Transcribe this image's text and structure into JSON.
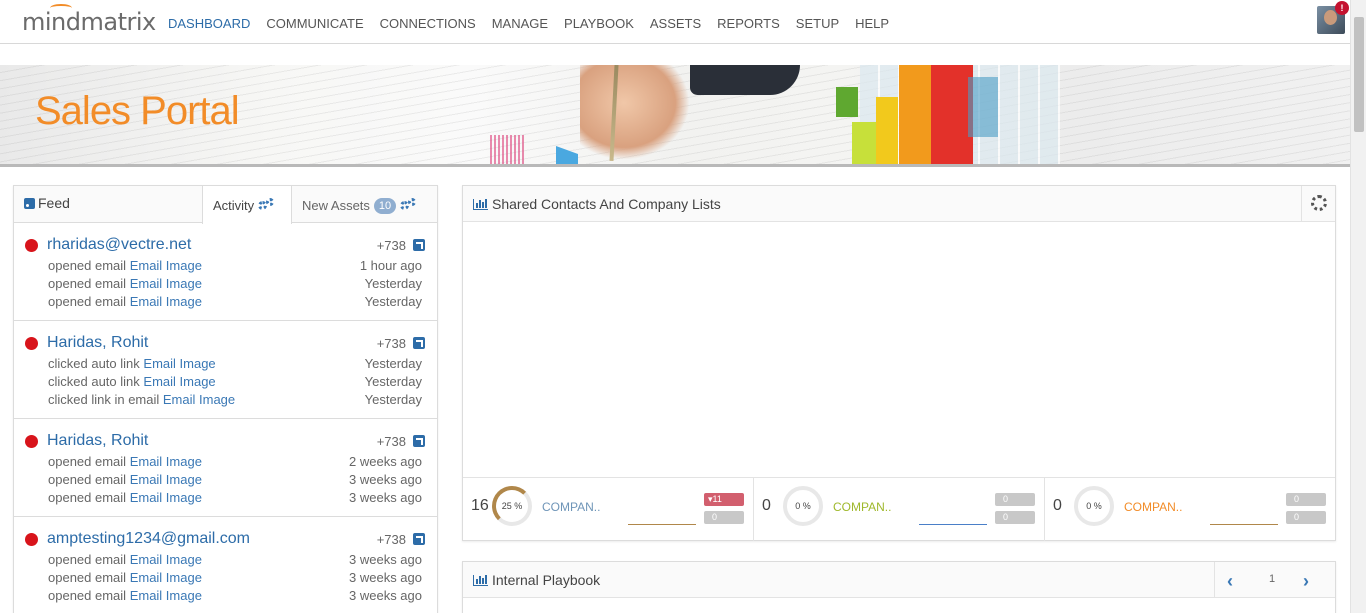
{
  "brand": {
    "logo_text": "mindmatrix"
  },
  "nav": {
    "items": [
      {
        "label": "DASHBOARD",
        "active": true
      },
      {
        "label": "COMMUNICATE"
      },
      {
        "label": "CONNECTIONS"
      },
      {
        "label": "MANAGE"
      },
      {
        "label": "PLAYBOOK"
      },
      {
        "label": "ASSETS"
      },
      {
        "label": "REPORTS"
      },
      {
        "label": "SETUP"
      },
      {
        "label": "HELP"
      }
    ],
    "notification_badge": "!"
  },
  "banner": {
    "title": "Sales Portal"
  },
  "feed": {
    "title": "Feed",
    "tab_activity": "Activity",
    "tab_new_assets": "New Assets",
    "new_assets_count": "10",
    "items": [
      {
        "name": "rharidas@vectre.net",
        "score": "+738",
        "activities": [
          {
            "action": "opened email",
            "link": "Email Image",
            "time": "1 hour ago"
          },
          {
            "action": "opened email",
            "link": "Email Image",
            "time": "Yesterday"
          },
          {
            "action": "opened email",
            "link": "Email Image",
            "time": "Yesterday"
          }
        ]
      },
      {
        "name": "Haridas, Rohit",
        "score": "+738",
        "activities": [
          {
            "action": "clicked auto link",
            "link": "Email Image",
            "time": "Yesterday"
          },
          {
            "action": "clicked auto link",
            "link": "Email Image",
            "time": "Yesterday"
          },
          {
            "action": "clicked link in email",
            "link": "Email Image",
            "time": "Yesterday"
          }
        ]
      },
      {
        "name": "Haridas, Rohit",
        "score": "+738",
        "activities": [
          {
            "action": "opened email",
            "link": "Email Image",
            "time": "2 weeks ago"
          },
          {
            "action": "opened email",
            "link": "Email Image",
            "time": "3 weeks ago"
          },
          {
            "action": "opened email",
            "link": "Email Image",
            "time": "3 weeks ago"
          }
        ]
      },
      {
        "name": "amptesting1234@gmail.com",
        "score": "+738",
        "activities": [
          {
            "action": "opened email",
            "link": "Email Image",
            "time": "3 weeks ago"
          },
          {
            "action": "opened email",
            "link": "Email Image",
            "time": "3 weeks ago"
          },
          {
            "action": "opened email",
            "link": "Email Image",
            "time": "3 weeks ago"
          }
        ]
      }
    ]
  },
  "shared": {
    "title": "Shared Contacts And Company Lists",
    "stats": [
      {
        "count": "16",
        "percent": "25 %",
        "percent_value": 25,
        "label": "COMPAN..",
        "label_color": "#6f95b8",
        "spark_color": "#b0874a",
        "top_value": "11",
        "top_trend": "down",
        "bottom_value": "0"
      },
      {
        "count": "0",
        "percent": "0 %",
        "percent_value": 0,
        "label": "COMPAN..",
        "label_color": "#9fb82b",
        "spark_color": "#4a7fc8",
        "top_value": "0",
        "top_trend": "",
        "bottom_value": "0"
      },
      {
        "count": "0",
        "percent": "0 %",
        "percent_value": 0,
        "label": "COMPAN..",
        "label_color": "#f28c28",
        "spark_color": "#b0874a",
        "top_value": "0",
        "top_trend": "",
        "bottom_value": "0"
      }
    ]
  },
  "playbook": {
    "title": "Internal Playbook",
    "page": "1"
  },
  "colors": {
    "accent": "#2d6ca8",
    "brand_orange": "#f28c28",
    "status_dot": "#d8141b"
  }
}
